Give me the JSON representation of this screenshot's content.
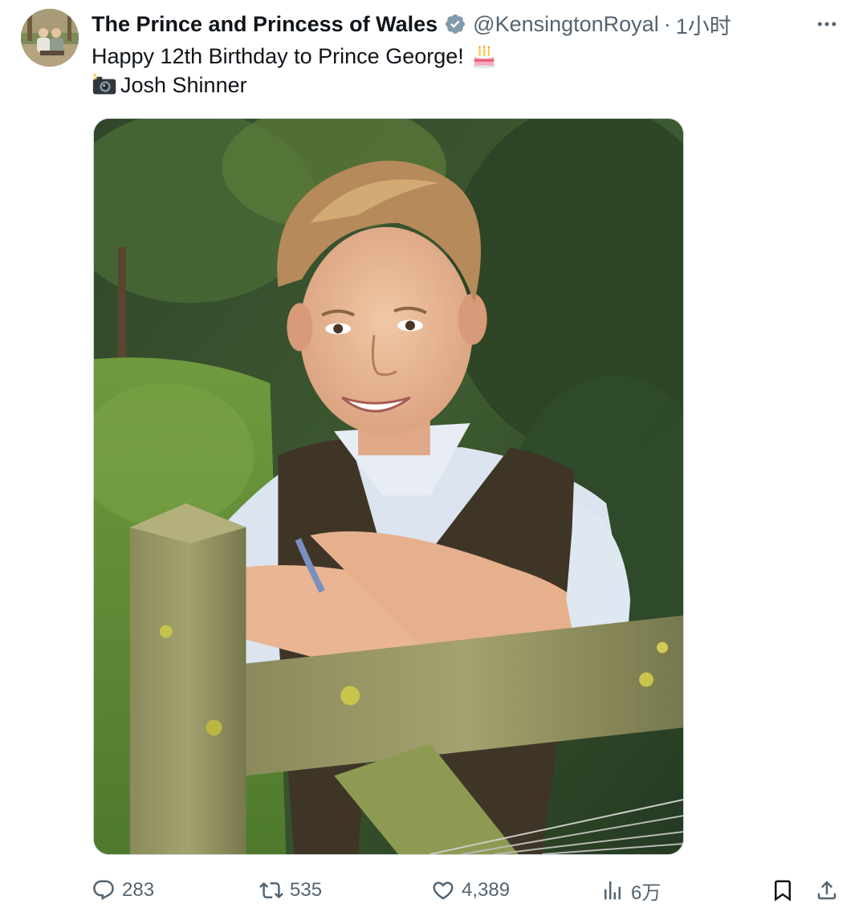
{
  "post": {
    "author": {
      "display_name": "The Prince and Princess of Wales",
      "handle": "@KensingtonRoyal",
      "separator": "·",
      "time": "1小时",
      "verified": true,
      "verified_color": "#829aab"
    },
    "text_line1": "Happy 12th Birthday to Prince George!",
    "text_line1_emoji": "birthday-cake-emoji",
    "text_line2_emoji": "camera-with-flash-emoji",
    "text_line2": "Josh Shinner",
    "media": {
      "type": "photo",
      "icon": "photo"
    }
  },
  "actions": {
    "reply_count": "283",
    "repost_count": "535",
    "like_count": "4,389",
    "view_count": "6万"
  },
  "colors": {
    "text_primary": "#0f1419",
    "text_secondary": "#536471",
    "border": "#cfd9de"
  }
}
